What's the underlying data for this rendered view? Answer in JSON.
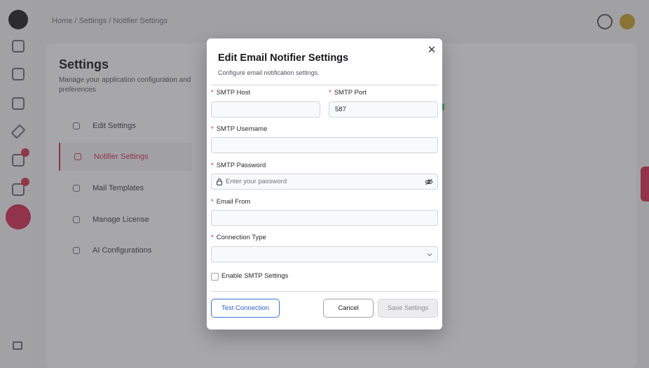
{
  "background": {
    "breadcrumb": "Home / Settings / Notifier Settings",
    "settings_title": "Settings",
    "settings_subtitle": "Manage your application configuration and preferences",
    "settings_nav": [
      {
        "label": "Edit Settings",
        "active": false
      },
      {
        "label": "Notifier Settings",
        "active": true
      },
      {
        "label": "Mail Templates",
        "active": false
      },
      {
        "label": "Manage License",
        "active": false
      },
      {
        "label": "AI Configurations",
        "active": false
      }
    ]
  },
  "modal": {
    "title": "Edit Email Notifier Settings",
    "subtitle": "Configure email notification settings.",
    "close_icon": "close-icon",
    "fields": {
      "smtp_host": {
        "label": "SMTP Host",
        "value": "",
        "required": true
      },
      "smtp_port": {
        "label": "SMTP Port",
        "value": "587",
        "required": true
      },
      "smtp_username": {
        "label": "SMTP Username",
        "value": "",
        "required": true
      },
      "smtp_password": {
        "label": "SMTP Password",
        "placeholder": "Enter your password",
        "required": true
      },
      "email_from": {
        "label": "Email From",
        "value": "",
        "required": true
      },
      "connection_type": {
        "label": "Connection Type",
        "value": "",
        "required": true
      }
    },
    "required_marker": "*",
    "enable_smtp": {
      "label": "Enable SMTP Settings",
      "checked": false
    },
    "buttons": {
      "test": "Test Connection",
      "cancel": "Cancel",
      "save": "Save Settings"
    }
  },
  "colors": {
    "accent": "#d62d55",
    "link_blue": "#2c5fc9",
    "required": "#e11d48"
  }
}
